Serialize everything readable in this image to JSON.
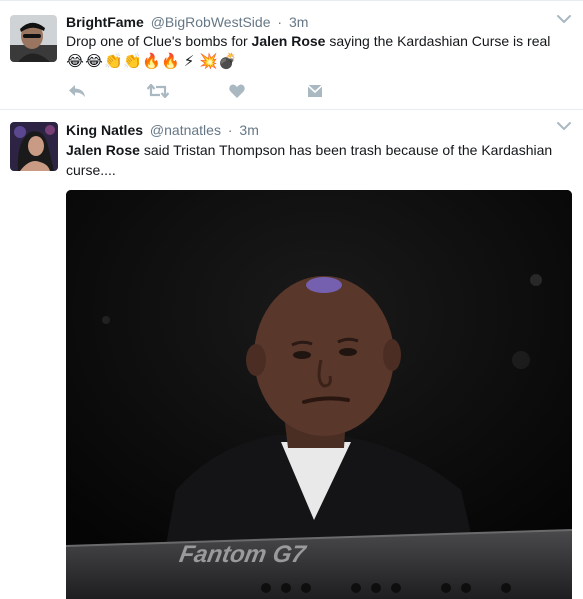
{
  "tweets": [
    {
      "fullname": "BrightFame",
      "username": "@BigRobWestSide",
      "separator": "·",
      "time": "3m",
      "text_before": "Drop one of Clue's bombs for ",
      "text_bold": "Jalen Rose",
      "text_after": " saying the Kardashian Curse is real",
      "emojis": [
        "😂",
        "😂",
        "👏",
        "👏",
        "🔥",
        "🔥",
        "⚡",
        "💥",
        "💣"
      ]
    },
    {
      "fullname": "King Natles",
      "username": "@natnatles",
      "separator": "·",
      "time": "3m",
      "text_bold": "Jalen Rose",
      "text_after": " said Tristan Thompson has been trash because of the Kardashian curse....",
      "media": {
        "keyboard_brand": "Fantom G7"
      }
    }
  ],
  "icons": {
    "reply": "reply-icon",
    "retweet": "retweet-icon",
    "like": "heart-icon",
    "dm": "direct-message-icon",
    "caret": "chevron-down-icon"
  },
  "colors": {
    "action_gray": "#aab8c2",
    "meta_gray": "#657786",
    "divider": "#e6ecf0"
  }
}
